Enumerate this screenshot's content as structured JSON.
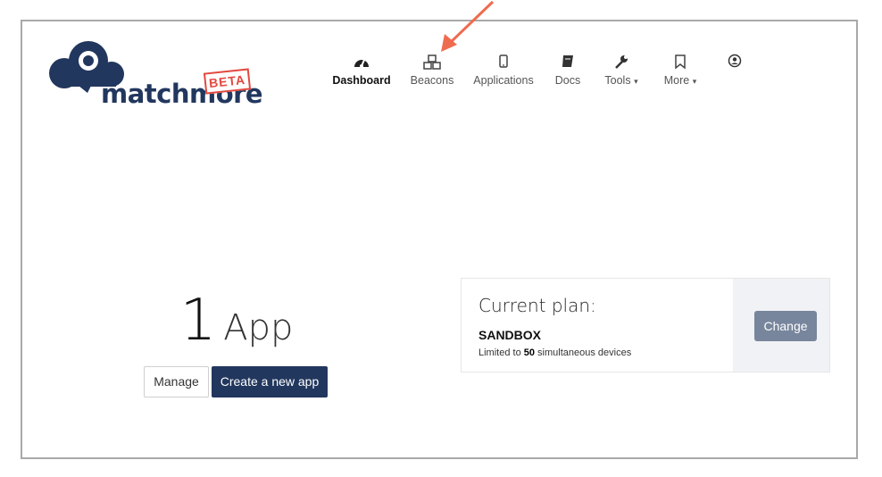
{
  "logo": {
    "word": "matchmore",
    "badge": "BETA"
  },
  "nav": {
    "items": [
      {
        "label": "Dashboard",
        "icon": "dashboard-gauge-icon",
        "active": true
      },
      {
        "label": "Beacons",
        "icon": "cubes-icon"
      },
      {
        "label": "Applications",
        "icon": "mobile-icon"
      },
      {
        "label": "Docs",
        "icon": "book-icon"
      },
      {
        "label": "Tools",
        "icon": "wrench-icon",
        "dropdown": true
      },
      {
        "label": "More",
        "icon": "bookmark-icon",
        "dropdown": true
      }
    ],
    "user_icon": "user-circle-icon"
  },
  "apps": {
    "count": "1",
    "unit": "App",
    "manage_label": "Manage",
    "create_label": "Create a new app"
  },
  "plan": {
    "title": "Current plan:",
    "name": "SANDBOX",
    "limit_prefix": "Limited to ",
    "limit_value": "50",
    "limit_suffix": " simultaneous devices",
    "change_label": "Change"
  },
  "colors": {
    "brand": "#22375e",
    "accent": "#e2493f",
    "button_secondary": "#77869c"
  }
}
